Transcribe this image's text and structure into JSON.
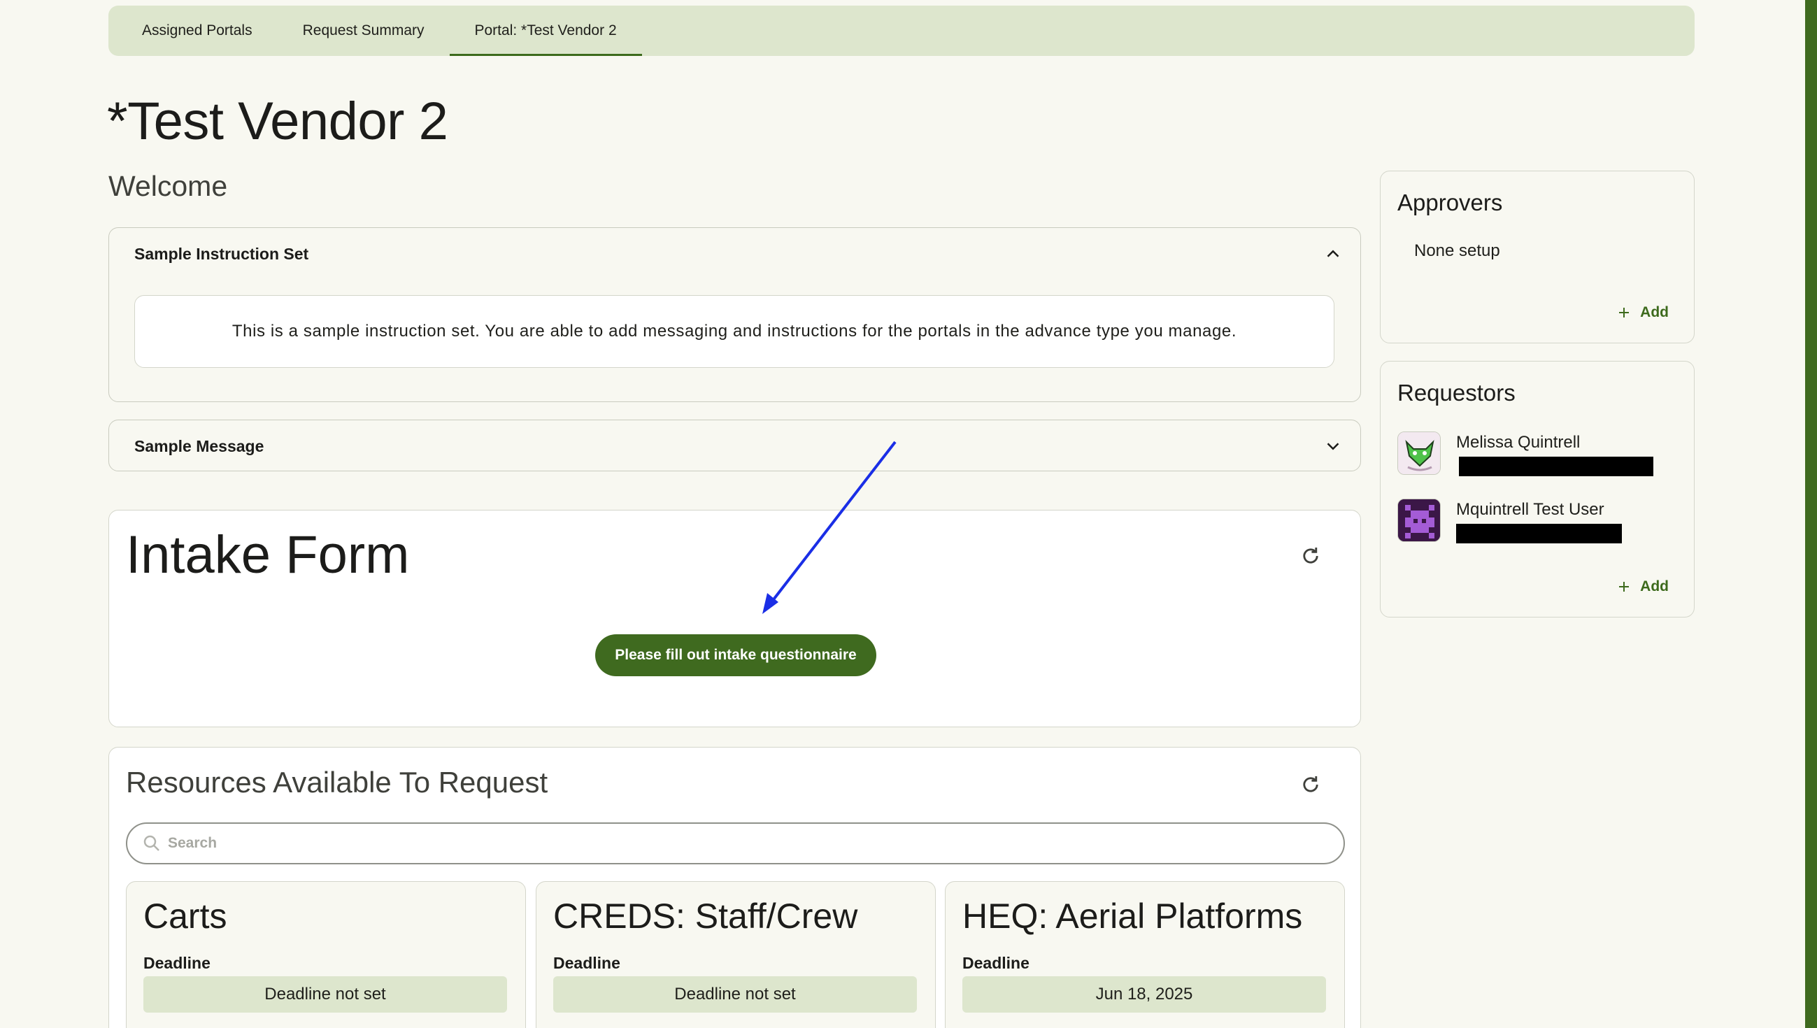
{
  "tabs": [
    {
      "label": "Assigned Portals",
      "active": false
    },
    {
      "label": "Request Summary",
      "active": false
    },
    {
      "label": "Portal: *Test Vendor 2",
      "active": true
    }
  ],
  "page": {
    "title": "*Test Vendor 2",
    "welcome": "Welcome"
  },
  "instructions": {
    "header": "Sample Instruction Set",
    "expanded": true,
    "body": "This is a sample instruction set. You are able to add messaging and instructions for the portals in the advance type you manage."
  },
  "message": {
    "header": "Sample Message",
    "expanded": false
  },
  "intake": {
    "title": "Intake Form",
    "button_label": "Please fill out intake questionnaire"
  },
  "resources": {
    "title": "Resources Available To Request",
    "search_placeholder": "Search",
    "deadline_label": "Deadline",
    "items": [
      {
        "name": "Carts",
        "deadline": "Deadline not set"
      },
      {
        "name": "CREDS: Staff/Crew",
        "deadline": "Deadline not set"
      },
      {
        "name": "HEQ: Aerial Platforms",
        "deadline": "Jun 18, 2025"
      }
    ]
  },
  "approvers": {
    "title": "Approvers",
    "empty_text": "None setup",
    "add_label": "Add"
  },
  "requestors": {
    "title": "Requestors",
    "add_label": "Add",
    "people": [
      {
        "name": "Melissa Quintrell",
        "avatar": "green-dragon-avatar"
      },
      {
        "name": "Mquintrell Test User",
        "avatar": "purple-pixel-avatar"
      }
    ]
  },
  "colors": {
    "primary": "#3f6a1f",
    "tab_bar": "#dde6cd",
    "background": "#f8f8f1",
    "annotation_arrow": "#1a2ee6"
  }
}
